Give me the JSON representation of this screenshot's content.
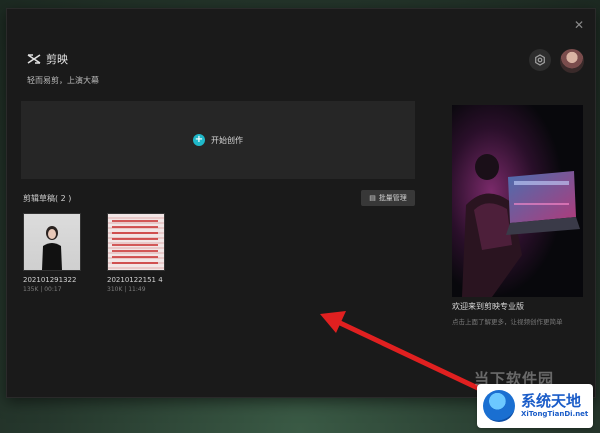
{
  "app": {
    "name": "剪映",
    "slogan": "轻而易剪，上演大幕",
    "close_icon": "close-icon",
    "settings_icon": "gear-icon"
  },
  "create": {
    "label": "开始创作",
    "icon": "plus-circle-icon",
    "accent": "#1fb8c9"
  },
  "drafts": {
    "title": "剪辑草稿( 2 )",
    "batch_label": "批量管理",
    "items": [
      {
        "name": "202101291322",
        "meta": "135K | 00:17"
      },
      {
        "name": "20210122151 4",
        "meta": "310K | 11:49"
      }
    ]
  },
  "promo": {
    "title": "欢迎来到剪映专业版",
    "desc": "点击上面了解更多，让视频创作更简单"
  },
  "watermark": {
    "text": "当下软件园",
    "badge_cn": "系统天地",
    "badge_en": "XiTongTianDi.net"
  },
  "colors": {
    "window_bg": "#1a1a1a",
    "arrow": "#e02020"
  }
}
